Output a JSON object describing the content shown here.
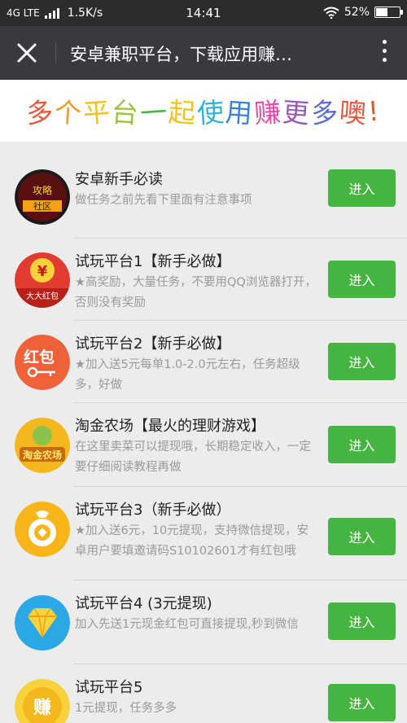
{
  "status_bar": {
    "network": "4G LTE",
    "speed": "1.5K/s",
    "time": "14:41",
    "battery": "52%",
    "battery_level": 0.52
  },
  "title_bar": {
    "title": "安卓兼职平台，下载应用赚…",
    "close_icon": "close-icon",
    "more_icon": "more-vertical-icon"
  },
  "banner": {
    "chars": [
      {
        "t": "多",
        "c": "#e8573a"
      },
      {
        "t": "个",
        "c": "#f19b2c"
      },
      {
        "t": "平",
        "c": "#f0c419"
      },
      {
        "t": "台",
        "c": "#9bc53d"
      },
      {
        "t": "一",
        "c": "#4cb648"
      },
      {
        "t": "起",
        "c": "#f0c419"
      },
      {
        "t": "使",
        "c": "#2fb3d6"
      },
      {
        "t": "用",
        "c": "#3d82d6"
      },
      {
        "t": "赚",
        "c": "#e94aa3"
      },
      {
        "t": "更",
        "c": "#9b59b6"
      },
      {
        "t": "多",
        "c": "#5a6ad6"
      },
      {
        "t": "噢",
        "c": "#e8573a"
      },
      {
        "t": "!",
        "c": "#e8573a"
      }
    ]
  },
  "items": [
    {
      "title": "安卓新手必读",
      "desc": "做任务之前先看下里面有注意事项",
      "button": "进入",
      "icon": "guide-community-icon",
      "icon_text": "攻略社区"
    },
    {
      "title": "试玩平台1【新手必做】",
      "desc": "★高奖励，大量任务，不要用QQ浏览器打开，否则没有奖励",
      "button": "进入",
      "icon": "yuan-red-envelope-icon",
      "icon_text": "大大红包"
    },
    {
      "title": "试玩平台2【新手必做】",
      "desc": "★加入送5元每单1.0-2.0元左右，任务超级多，好做",
      "button": "进入",
      "icon": "red-envelope-key-icon",
      "icon_text": "红包"
    },
    {
      "title": "淘金农场【最火的理财游戏】",
      "desc": "在这里卖菜可以提现哦，长期稳定收入，一定要仔细阅读教程再做",
      "button": "进入",
      "icon": "gold-farm-icon",
      "icon_text": "淘金农场"
    },
    {
      "title": "试玩平台3（新手必做）",
      "desc": "★加入送6元，10元提现，支持微信提现，安卓用户要填邀请码S10102601才有红包哦",
      "button": "进入",
      "icon": "coin-bag-icon",
      "icon_text": ""
    },
    {
      "title": "试玩平台4 (3元提现)",
      "desc": "加入先送1元现金红包可直接提现,秒到微信",
      "button": "进入",
      "icon": "diamond-icon",
      "icon_text": ""
    },
    {
      "title": "试玩平台5",
      "desc": "1元提现，任务多多",
      "button": "进入",
      "icon": "earn-coin-icon",
      "icon_text": "赚"
    }
  ]
}
